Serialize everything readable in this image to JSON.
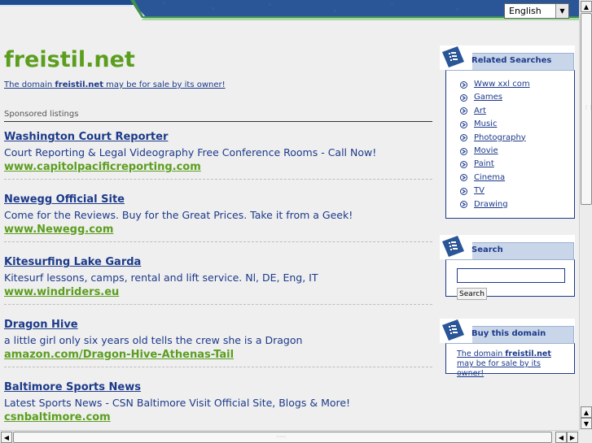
{
  "header": {
    "language": "English"
  },
  "main": {
    "domain_title": "freistil.net",
    "sale_prefix": "The domain ",
    "sale_domain": "freistil.net",
    "sale_suffix": " may be for sale by its owner!",
    "sponsored_label": "Sponsored listings",
    "listings": [
      {
        "title": "Washington Court Reporter",
        "desc": "Court Reporting & Legal Videography Free Conference Rooms - Call Now!",
        "url": "www.capitolpacificreporting.com"
      },
      {
        "title": "Newegg Official Site",
        "desc": "Come for the Reviews. Buy for the Great Prices. Take it from a Geek!",
        "url": "www.Newegg.com"
      },
      {
        "title": "Kitesurfing Lake Garda",
        "desc": "Kitesurf lessons, camps, rental and lift service. Nl, DE, Eng, IT",
        "url": "www.windriders.eu"
      },
      {
        "title": "Dragon Hive",
        "desc": "a little girl only six years old tells the crew she is a Dragon",
        "url": "amazon.com/Dragon-Hive-Athenas-Tail"
      },
      {
        "title": "Baltimore Sports News",
        "desc": "Latest Sports News - CSN Baltimore Visit Official Site, Blogs & More!",
        "url": "csnbaltimore.com"
      }
    ]
  },
  "sidebar": {
    "related_title": "Related Searches",
    "related": [
      "Www xxl com",
      "Games",
      "Art",
      "Music",
      "Photography",
      "Movie",
      "Paint",
      "Cinema",
      "TV",
      "Drawing"
    ],
    "search_title": "Search",
    "search_button": "Search",
    "buy_title": "Buy this domain",
    "buy_prefix": "The domain ",
    "buy_domain": "freistil.net",
    "buy_suffix": " may be for sale by its owner!"
  },
  "colors": {
    "brand_green": "#5b9e1e",
    "link_blue": "#1c3a8a",
    "panel_header": "#c9d6e9"
  }
}
